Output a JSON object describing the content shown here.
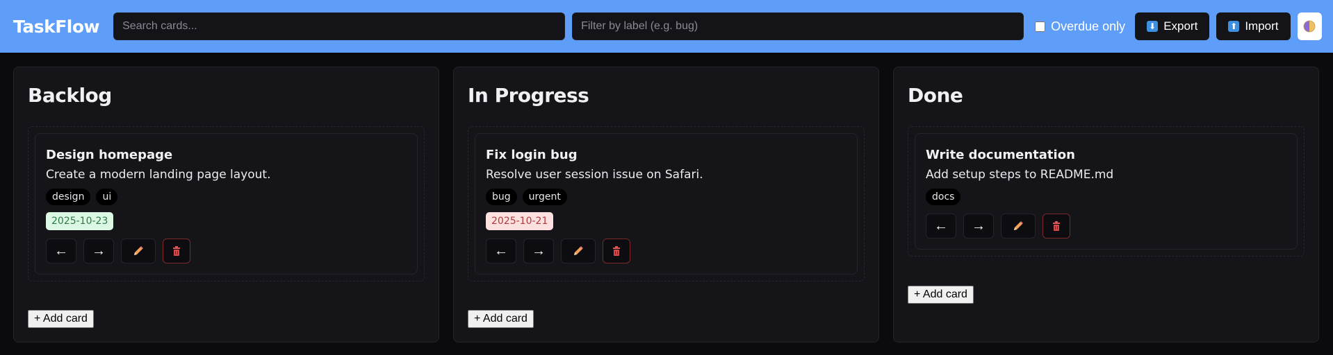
{
  "header": {
    "brand": "TaskFlow",
    "search_placeholder": "Search cards...",
    "filter_placeholder": "Filter by label (e.g. bug)",
    "overdue_label": "Overdue only",
    "export_label": "Export",
    "import_label": "Import"
  },
  "add_card_label": "+ Add card",
  "columns": [
    {
      "title": "Backlog",
      "cards": [
        {
          "title": "Design homepage",
          "description": "Create a modern landing page layout.",
          "labels": [
            "design",
            "ui"
          ],
          "due": "2025-10-23",
          "due_status": "ok"
        }
      ]
    },
    {
      "title": "In Progress",
      "cards": [
        {
          "title": "Fix login bug",
          "description": "Resolve user session issue on Safari.",
          "labels": [
            "bug",
            "urgent"
          ],
          "due": "2025-10-21",
          "due_status": "overdue"
        }
      ]
    },
    {
      "title": "Done",
      "cards": [
        {
          "title": "Write documentation",
          "description": "Add setup steps to README.md",
          "labels": [
            "docs"
          ],
          "due": "",
          "due_status": "none"
        }
      ]
    }
  ],
  "card_actions": {
    "move_left_icon": "←",
    "move_right_icon": "→",
    "edit_icon": "pencil-icon",
    "delete_icon": "trash-icon"
  },
  "colors": {
    "header_bg": "#5f9ef8",
    "page_bg": "#0b0b0e",
    "column_bg": "#141419",
    "due_ok_bg": "#dcf7e4",
    "due_overdue_bg": "#fde0e0"
  }
}
